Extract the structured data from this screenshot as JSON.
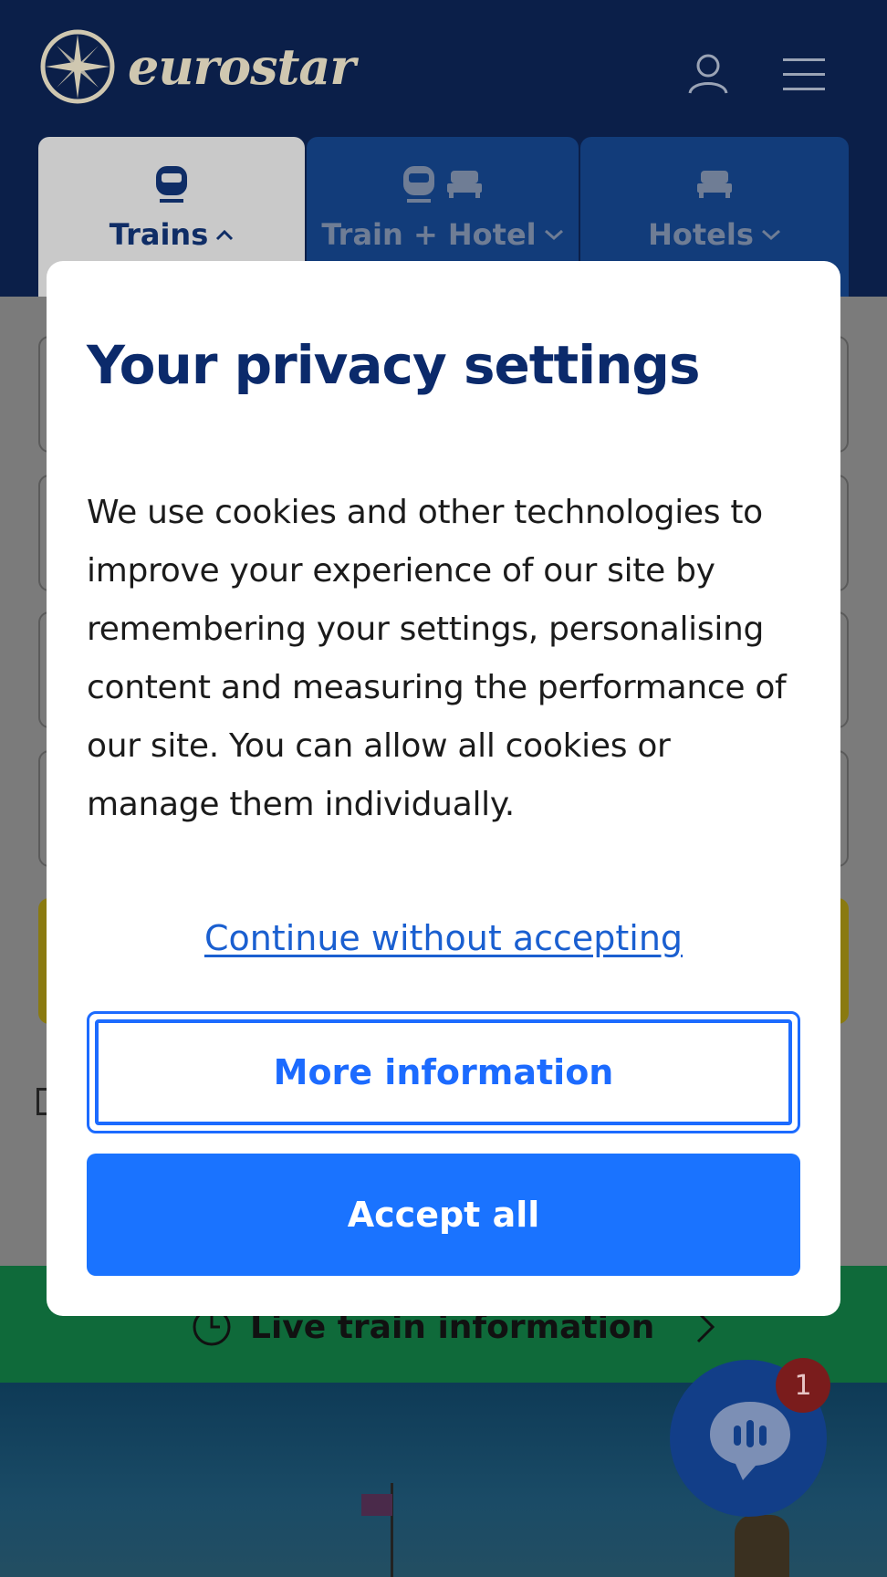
{
  "colors": {
    "header_bg": "#0b1f49",
    "modal_title": "#0b2a6b",
    "link": "#1a5fd0",
    "primary_button": "#1a73ff",
    "overlay": "#7b7b7b"
  },
  "header": {
    "logo_text": "eurostar",
    "account_icon": "user-icon",
    "menu_icon": "hamburger-menu-icon"
  },
  "tabs": [
    {
      "label": "Trains",
      "icons": [
        "train-icon"
      ],
      "chevron": "chevron-up-icon",
      "active": true
    },
    {
      "label": "Train + Hotel",
      "icons": [
        "train-icon",
        "bed-icon"
      ],
      "chevron": "chevron-down-icon",
      "active": false
    },
    {
      "label": "Hotels",
      "icons": [
        "bed-icon"
      ],
      "chevron": "chevron-down-icon",
      "active": false
    }
  ],
  "live_bar": {
    "label": "Live train information",
    "icon": "clock-icon"
  },
  "chat": {
    "badge_count": "1",
    "icon": "chat-icon"
  },
  "modal": {
    "title": "Your privacy settings",
    "body": "We use cookies and other technologies to improve your experience of our site by remembering your settings, personalising content and measuring the performance of our site. You can allow all cookies or manage them individually.",
    "continue_link": "Continue without accepting",
    "more_info_label": "More information",
    "accept_label": "Accept all"
  }
}
